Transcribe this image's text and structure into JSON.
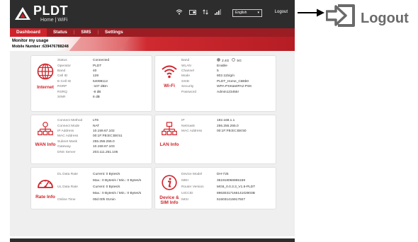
{
  "header": {
    "brand": "PLDT",
    "subbrand": "Home | WiFi",
    "language": "English",
    "logout": "Logout"
  },
  "nav": {
    "tabs": [
      {
        "label": "Dashboard",
        "active": true
      },
      {
        "label": "Status"
      },
      {
        "label": "SMS"
      },
      {
        "label": "Settings"
      }
    ]
  },
  "banner": {
    "monitor": "Monitor my usage",
    "mobile_label": "Mobile Number :",
    "mobile_value": "639476788248"
  },
  "internet": {
    "title": "Internet",
    "rows": [
      {
        "label": "Status",
        "value": "Connected"
      },
      {
        "label": "Operator",
        "value": "PLDT"
      },
      {
        "label": "Band",
        "value": "40"
      },
      {
        "label": "Cell ID",
        "value": "128"
      },
      {
        "label": "E-Cell ID",
        "value": "54098112"
      },
      {
        "label": "RSRP",
        "value": "-107 dBm"
      },
      {
        "label": "RSRQ",
        "value": "-8 dB"
      },
      {
        "label": "SINR",
        "value": "6 dB"
      }
    ]
  },
  "wifi": {
    "title": "Wi-Fi",
    "band_label": "Band",
    "band_options": [
      "2.4G",
      "5G"
    ],
    "rows": [
      {
        "label": "WLAN",
        "value": "Enable"
      },
      {
        "label": "Channel",
        "value": "5"
      },
      {
        "label": "Mode",
        "value": "802.11b/g/n"
      },
      {
        "label": "SSID",
        "value": "PLDT_Home_CB8b0"
      },
      {
        "label": "Security",
        "value": "WPA-PSK&WPA2-PSK"
      },
      {
        "label": "Password",
        "value": "Admin123456!"
      }
    ]
  },
  "wan": {
    "title": "WAN Info",
    "rows": [
      {
        "label": "Connect Method",
        "value": "LTE"
      },
      {
        "label": "Connect Mode",
        "value": "NAT"
      },
      {
        "label": "IP Address",
        "value": "10.159.67.102"
      },
      {
        "label": "MAC Address",
        "value": "00:1F:FB:EC:B8:51"
      },
      {
        "label": "Subnet Mask",
        "value": "255.255.255.0"
      },
      {
        "label": "Gateway",
        "value": "10.159.67.103"
      },
      {
        "label": "DNS Server",
        "value": "203.111.251.106"
      }
    ]
  },
  "lan": {
    "title": "LAN Info",
    "rows": [
      {
        "label": "IP",
        "value": "192.168.1.1"
      },
      {
        "label": "Netmask",
        "value": "255.255.255.0"
      },
      {
        "label": "MAC Address",
        "value": "00:1F:FB:EC:B8:50"
      }
    ]
  },
  "rate": {
    "title": "Rate Info",
    "rows": [
      {
        "label": "DL Data Rate",
        "value": "Current: 0 Bytes/s"
      },
      {
        "label": "",
        "value": "Max.: 0 Bytes/s / Min.: 0 Bytes/s"
      },
      {
        "label": "UL Data Rate",
        "value": "Current: 0 Bytes/s"
      },
      {
        "label": "",
        "value": "Max.: 0 Bytes/s / Min.: 0 Bytes/s"
      },
      {
        "label": "Online Time",
        "value": "00d 00h 01min"
      }
    ]
  },
  "device": {
    "title_line1": "Device &",
    "title_line2": "SIM Info",
    "rows": [
      {
        "label": "Device Model",
        "value": "DH-725"
      },
      {
        "label": "IMEI",
        "value": "351918066965159"
      },
      {
        "label": "Router Version",
        "value": "MG8_0.0.3.3_V1.6-PLDT"
      },
      {
        "label": "UICCID",
        "value": "8963031716614102903B"
      },
      {
        "label": "IMSI",
        "value": "515031415917927"
      }
    ]
  },
  "callout": {
    "label": "Logout"
  },
  "colors": {
    "accent": "#d0232a",
    "nav": "#9b1d23",
    "topbar": "#2d2d2d",
    "callout_icon": "#6a6a6a"
  }
}
